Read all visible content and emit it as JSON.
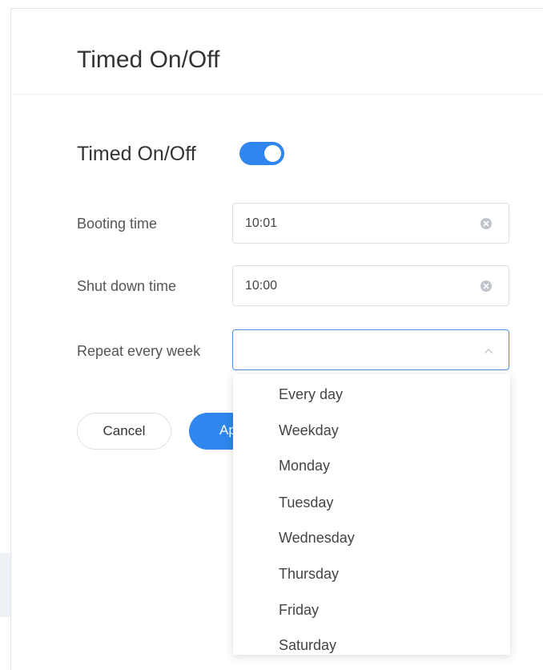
{
  "header": {
    "title": "Timed On/Off"
  },
  "section": {
    "title": "Timed On/Off",
    "toggle_on": true
  },
  "fields": {
    "booting": {
      "label": "Booting time",
      "value": "10:01"
    },
    "shutdown": {
      "label": "Shut down time",
      "value": "10:00"
    },
    "repeat": {
      "label": "Repeat every week",
      "value": ""
    }
  },
  "buttons": {
    "cancel": "Cancel",
    "apply": "Ap"
  },
  "dropdown": {
    "options": [
      "Every day",
      "Weekday",
      "Monday",
      "Tuesday",
      "Wednesday",
      "Thursday",
      "Friday",
      "Saturday"
    ]
  },
  "colors": {
    "accent": "#2e86ee",
    "border": "#dcdfe6",
    "focus_border": "#4a90e2"
  },
  "icons": {
    "clear": "clear-circle-icon",
    "chevron": "chevron-up-icon"
  }
}
